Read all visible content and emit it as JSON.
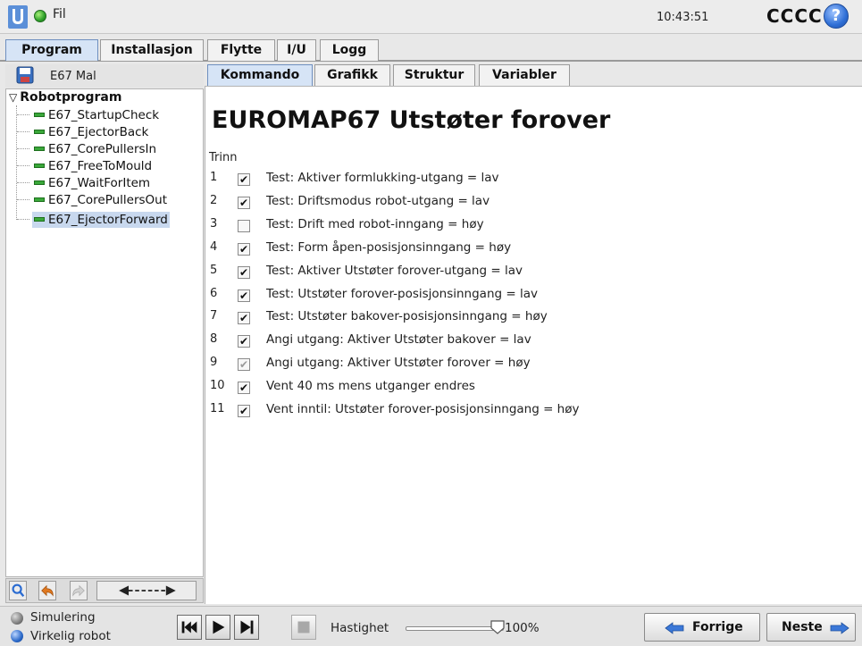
{
  "topbar": {
    "menu_file": "Fil",
    "clock": "10:43:51",
    "robot_name": "CCCC",
    "help_label": "?"
  },
  "main_tabs": [
    {
      "label": "Program",
      "active": true
    },
    {
      "label": "Installasjon",
      "active": false
    },
    {
      "label": "Flytte",
      "active": false
    },
    {
      "label": "I/U",
      "active": false
    },
    {
      "label": "Logg",
      "active": false
    }
  ],
  "left_panel": {
    "program_name": "E67 Mal",
    "tree_root": "Robotprogram",
    "tree_items": [
      {
        "label": "E67_StartupCheck",
        "selected": false
      },
      {
        "label": "E67_EjectorBack",
        "selected": false
      },
      {
        "label": "E67_CorePullersIn",
        "selected": false
      },
      {
        "label": "E67_FreeToMould",
        "selected": false
      },
      {
        "label": "E67_WaitForItem",
        "selected": false
      },
      {
        "label": "E67_CorePullersOut",
        "selected": false
      },
      {
        "label": "E67_EjectorForward",
        "selected": true
      }
    ]
  },
  "sub_tabs": [
    {
      "label": "Kommando",
      "active": true
    },
    {
      "label": "Grafikk",
      "active": false
    },
    {
      "label": "Struktur",
      "active": false
    },
    {
      "label": "Variabler",
      "active": false
    }
  ],
  "content": {
    "title": "EUROMAP67 Utstøter forover",
    "steps_header": "Trinn",
    "steps": [
      {
        "num": "1",
        "checked": true,
        "dim": false,
        "text": "Test: Aktiver formlukking-utgang = lav"
      },
      {
        "num": "2",
        "checked": true,
        "dim": false,
        "text": "Test: Driftsmodus robot-utgang = lav"
      },
      {
        "num": "3",
        "checked": false,
        "dim": false,
        "text": "Test: Drift med robot-inngang = høy"
      },
      {
        "num": "4",
        "checked": true,
        "dim": false,
        "text": "Test: Form åpen-posisjonsinngang = høy"
      },
      {
        "num": "5",
        "checked": true,
        "dim": false,
        "text": "Test: Aktiver Utstøter forover-utgang = lav"
      },
      {
        "num": "6",
        "checked": true,
        "dim": false,
        "text": "Test: Utstøter forover-posisjonsinngang = lav"
      },
      {
        "num": "7",
        "checked": true,
        "dim": false,
        "text": "Test: Utstøter bakover-posisjonsinngang = høy"
      },
      {
        "num": "8",
        "checked": true,
        "dim": false,
        "text": "Angi utgang: Aktiver Utstøter bakover = lav"
      },
      {
        "num": "9",
        "checked": true,
        "dim": true,
        "text": "Angi utgang: Aktiver Utstøter forover = høy"
      },
      {
        "num": "10",
        "checked": true,
        "dim": false,
        "text": "Vent 40 ms mens utganger endres"
      },
      {
        "num": "11",
        "checked": true,
        "dim": false,
        "text": "Vent inntil: Utstøter forover-posisjonsinngang = høy"
      }
    ]
  },
  "bottombar": {
    "sim_label": "Simulering",
    "real_label": "Virkelig robot",
    "speed_label": "Hastighet",
    "speed_value": "100%",
    "speed_fraction": 1.0,
    "prev_label": "Forrige",
    "next_label": "Neste"
  },
  "colors": {
    "accent_tab": "#d6e4f6",
    "selected_row": "#c8d8ee",
    "status_green": "#2ea12a",
    "help_blue": "#2f6fd6"
  }
}
